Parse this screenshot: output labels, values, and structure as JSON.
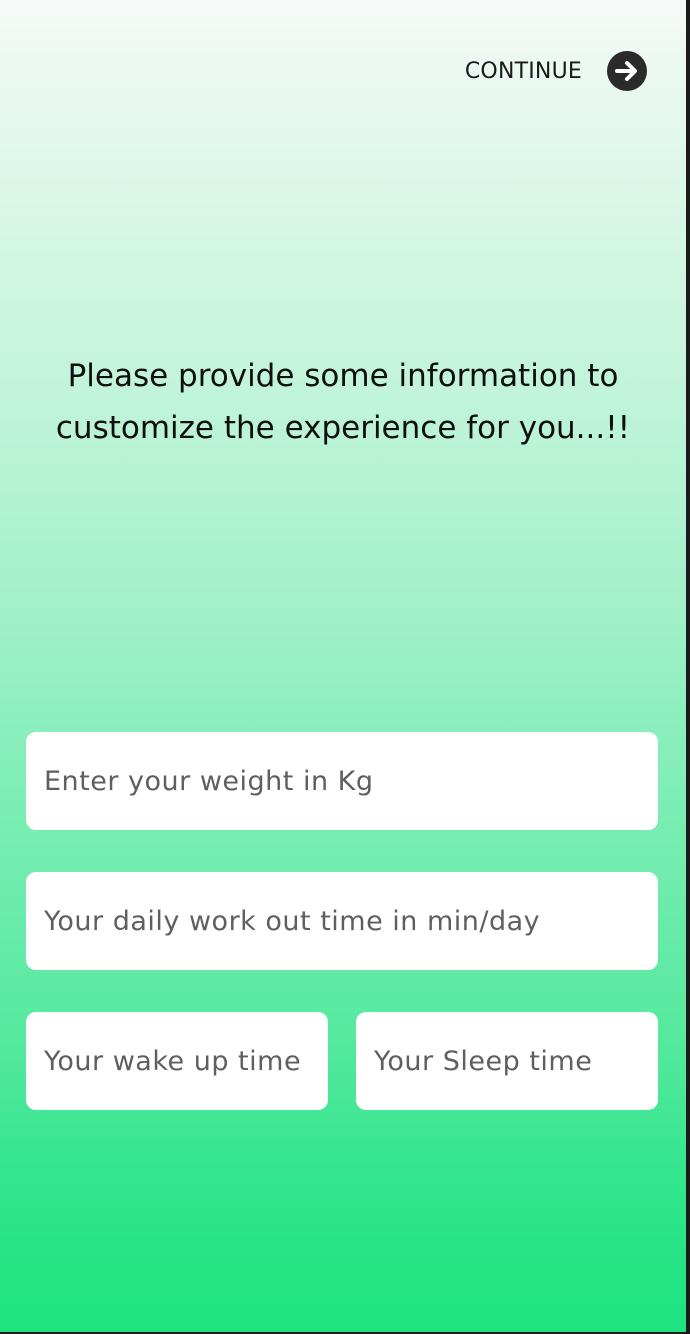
{
  "header": {
    "continue_label": "CONTINUE",
    "continue_icon": "arrow-right-circle-icon"
  },
  "intro": {
    "line1": "Please provide some information to",
    "line2": "customize the experience for you...!!"
  },
  "form": {
    "weight_placeholder": "Enter your weight in Kg",
    "workout_placeholder": "Your daily work out time in min/day",
    "wake_placeholder": "Your wake up time",
    "sleep_placeholder": "Your Sleep time"
  },
  "colors": {
    "gradient_top": "#f7f9f8",
    "gradient_bottom": "#1de37f",
    "icon_fill": "#2b2b2b",
    "field_bg": "#ffffff"
  }
}
